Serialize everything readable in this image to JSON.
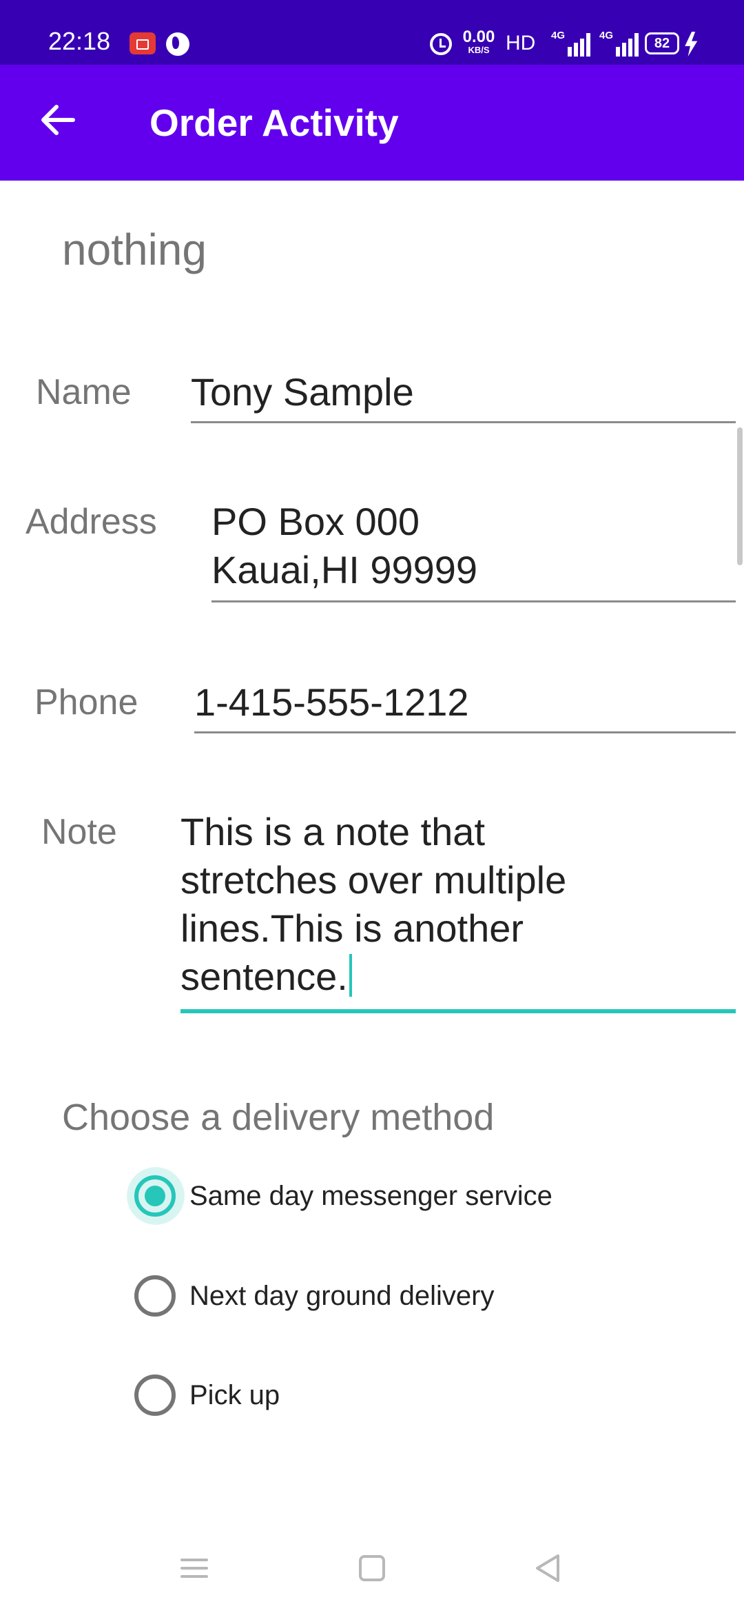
{
  "status_bar": {
    "time": "22:18",
    "net_speed_value": "0.00",
    "net_speed_unit": "KB/S",
    "hd_label": "HD",
    "signal_1": "4G",
    "signal_2": "4G",
    "battery_level": "82",
    "icons": [
      "screen-record-icon",
      "globe-icon",
      "alarm-icon",
      "battery-icon",
      "charging-bolt-icon"
    ]
  },
  "app_bar": {
    "title": "Order Activity",
    "back_icon": "arrow-back-icon"
  },
  "form": {
    "header": "nothing",
    "name": {
      "label": "Name",
      "value": "Tony Sample"
    },
    "address": {
      "label": "Address",
      "line1": "PO Box 000",
      "line2": "Kauai,HI 99999"
    },
    "phone": {
      "label": "Phone",
      "value": "1-415-555-1212"
    },
    "note": {
      "label": "Note",
      "lines": [
        "This is a note that",
        "stretches over multiple",
        "lines.This is another",
        "sentence."
      ]
    }
  },
  "delivery": {
    "title": "Choose a delivery method",
    "options": [
      {
        "label": "Same day messenger service",
        "checked": true
      },
      {
        "label": "Next day ground delivery",
        "checked": false
      },
      {
        "label": "Pick up",
        "checked": false
      }
    ]
  },
  "colors": {
    "status_bar": "#3700b3",
    "app_bar": "#6200ee",
    "accent": "#26c6b9",
    "label_gray": "#757575"
  },
  "nav_bar": {
    "icons": [
      "menu-icon",
      "home-square-icon",
      "back-triangle-icon"
    ]
  }
}
